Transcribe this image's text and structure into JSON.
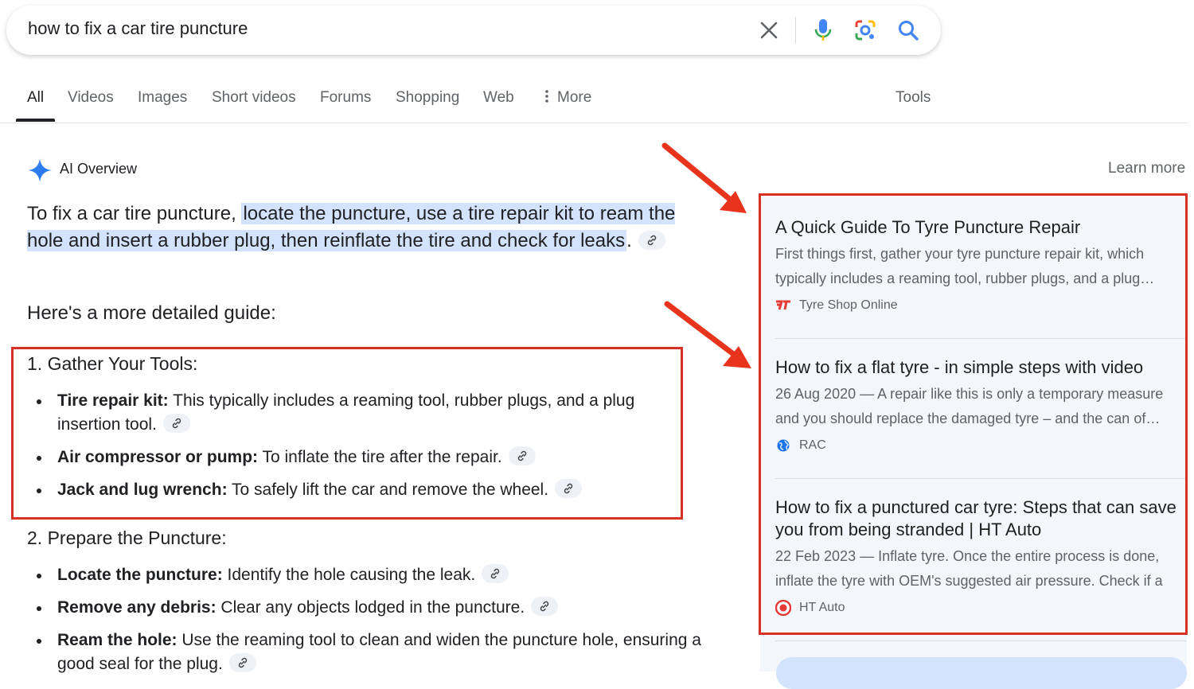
{
  "search": {
    "query": "how to fix a car tire puncture",
    "icons": [
      "close-icon",
      "microphone-icon",
      "lens-icon",
      "search-icon"
    ]
  },
  "tabs": [
    {
      "label": "All",
      "active": true
    },
    {
      "label": "Videos"
    },
    {
      "label": "Images"
    },
    {
      "label": "Short videos"
    },
    {
      "label": "Forums"
    },
    {
      "label": "Shopping"
    },
    {
      "label": "Web"
    },
    {
      "label": "More",
      "icon": "vertical-dots-icon"
    },
    {
      "label": "Tools"
    }
  ],
  "ai_overview": {
    "label": "AI Overview",
    "learn_more": "Learn more",
    "summary_prefix": "To fix a car tire puncture,",
    "summary_highlight": "locate the puncture, use a tire repair kit to ream the hole and insert a rubber plug, then reinflate the tire and check for leaks",
    "summary_suffix": ".",
    "detail_intro": "Here's a more detailed guide:",
    "sections": [
      {
        "heading": "1. Gather Your Tools:",
        "items": [
          {
            "bold": "Tire repair kit:",
            "text": " This typically includes a reaming tool, rubber plugs, and a plug insertion tool."
          },
          {
            "bold": "Air compressor or pump:",
            "text": " To inflate the tire after the repair."
          },
          {
            "bold": "Jack and lug wrench:",
            "text": " To safely lift the car and remove the wheel."
          }
        ]
      },
      {
        "heading": "2. Prepare the Puncture:",
        "items": [
          {
            "bold": "Locate the puncture:",
            "text": " Identify the hole causing the leak."
          },
          {
            "bold": "Remove any debris:",
            "text": " Clear any objects lodged in the puncture."
          },
          {
            "bold": "Ream the hole:",
            "text": " Use the reaming tool to clean and widen the puncture hole, ensuring a good seal for the plug."
          }
        ]
      }
    ]
  },
  "sources": [
    {
      "title": "A Quick Guide To Tyre Puncture Repair",
      "snippet_line1": "First things first, gather your tyre puncture repair kit, which",
      "snippet_line2": "typically includes a reaming tool, rubber plugs, and a plug…",
      "site": "Tyre Shop Online",
      "favicon": "tyre-shop-favicon"
    },
    {
      "title": "How to fix a flat tyre - in simple steps with video",
      "snippet_line1": "26 Aug 2020 — A repair like this is only a temporary measure",
      "snippet_line2": "and you should replace the damaged tyre – and the can of…",
      "site": "RAC",
      "favicon": "globe-icon"
    },
    {
      "title": "How to fix a punctured car tyre: Steps that can save you from being stranded | HT Auto",
      "snippet_line1": "22 Feb 2023 — Inflate tyre. Once the entire process is done,",
      "snippet_line2": "inflate the tyre with OEM's suggested air pressure. Check if a",
      "site": "HT Auto",
      "favicon": "ht-auto-favicon"
    }
  ],
  "colors": {
    "annotation_red": "#d93025",
    "highlight_blue": "#d3e3fd",
    "panel_bg": "#f3f6fa"
  }
}
